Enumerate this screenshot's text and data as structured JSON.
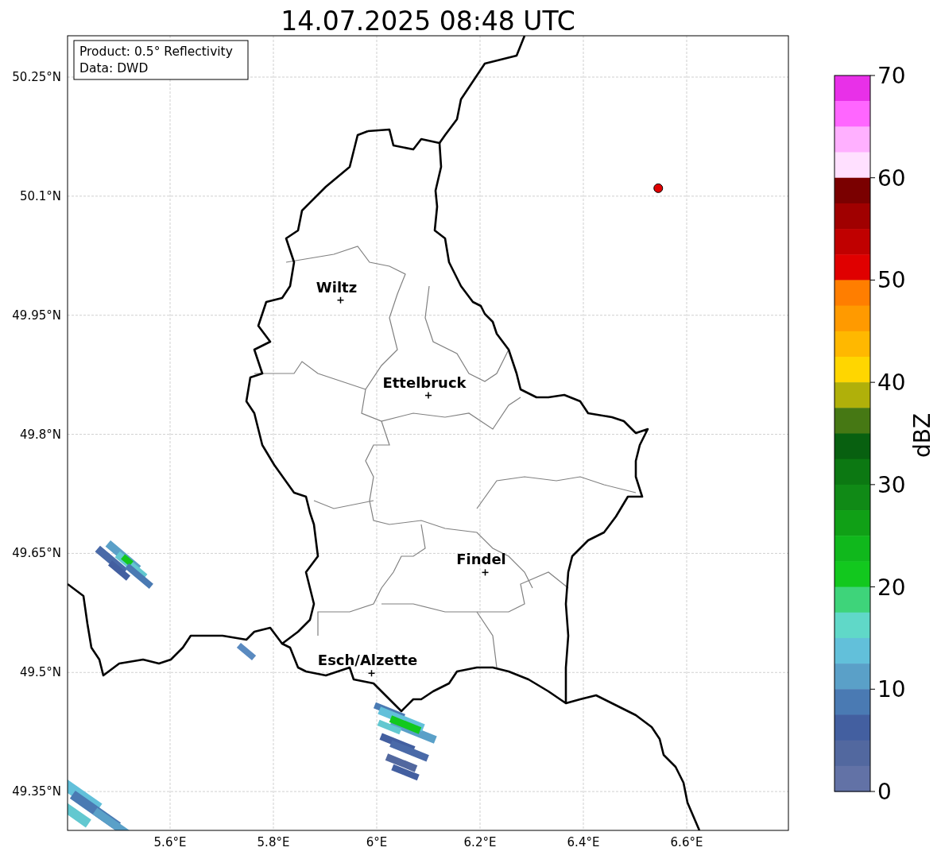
{
  "title": "14.07.2025 08:48 UTC",
  "info_box": {
    "lines": [
      "Product: 0.5° Reflectivity",
      "Data: DWD"
    ]
  },
  "map": {
    "x_ticks": [
      "5.6°E",
      "5.8°E",
      "6°E",
      "6.2°E",
      "6.4°E",
      "6.6°E"
    ],
    "y_ticks": [
      "50.25°N",
      "50.1°N",
      "49.95°N",
      "49.8°N",
      "49.65°N",
      "49.5°N",
      "49.35°N"
    ],
    "cities": [
      "Wiltz",
      "Ettelbruck",
      "Findel",
      "Esch/Alzette"
    ]
  },
  "colorbar": {
    "label": "dBZ",
    "ticks": [
      "70",
      "60",
      "50",
      "40",
      "30",
      "20",
      "10",
      "0"
    ],
    "bands": [
      {
        "color": "#e830e8"
      },
      {
        "color": "#ff66ff"
      },
      {
        "color": "#ffb0ff"
      },
      {
        "color": "#ffe0ff"
      },
      {
        "color": "#7a0000"
      },
      {
        "color": "#a00000"
      },
      {
        "color": "#c00000"
      },
      {
        "color": "#e00000"
      },
      {
        "color": "#ff7e00"
      },
      {
        "color": "#ff9a00"
      },
      {
        "color": "#ffb800"
      },
      {
        "color": "#ffd600"
      },
      {
        "color": "#b0b00a"
      },
      {
        "color": "#467814"
      },
      {
        "color": "#086010"
      },
      {
        "color": "#0c7812"
      },
      {
        "color": "#108a16"
      },
      {
        "color": "#10a016"
      },
      {
        "color": "#10b81c"
      },
      {
        "color": "#12c81e"
      },
      {
        "color": "#3ed47a"
      },
      {
        "color": "#60d8c8"
      },
      {
        "color": "#62c0da"
      },
      {
        "color": "#5aa0c8"
      },
      {
        "color": "#4a7ab3"
      },
      {
        "color": "#435fa0"
      },
      {
        "color": "#52689f"
      },
      {
        "color": "#6272a6"
      }
    ]
  }
}
